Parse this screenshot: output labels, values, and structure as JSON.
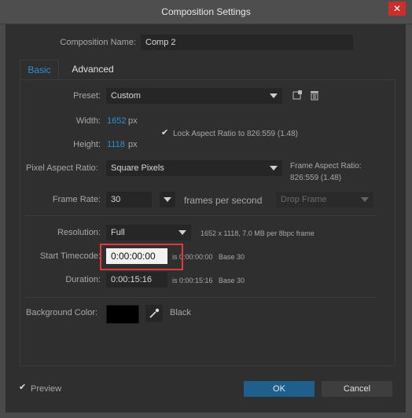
{
  "window": {
    "title": "Composition Settings",
    "close_label": "✕"
  },
  "comp_name": {
    "label": "Composition Name:",
    "value": "Comp 2"
  },
  "tabs": [
    {
      "label": "Basic",
      "active": true
    },
    {
      "label": "Advanced",
      "active": false
    }
  ],
  "preset": {
    "label": "Preset:",
    "value": "Custom"
  },
  "width": {
    "label": "Width:",
    "value": "1652",
    "unit": "px"
  },
  "height": {
    "label": "Height:",
    "value": "1118",
    "unit": "px"
  },
  "lock_aspect": {
    "checked": true,
    "label": "Lock Aspect Ratio to 826:559 (1.48)"
  },
  "pixel_aspect": {
    "label": "Pixel Aspect Ratio:",
    "value": "Square Pixels"
  },
  "frame_aspect": {
    "label": "Frame Aspect Ratio:",
    "value": "826:559 (1.48)"
  },
  "frame_rate": {
    "label": "Frame Rate:",
    "value": "30",
    "unit": "frames per second",
    "drop_frame": "Drop Frame"
  },
  "resolution": {
    "label": "Resolution:",
    "value": "Full",
    "info": "1652 x 1118, 7.0 MB per 8bpc frame"
  },
  "start_timecode": {
    "label": "Start Timecode:",
    "value": "0:00:00:00",
    "is": "is 0:00:00:00",
    "base": "Base 30"
  },
  "duration": {
    "label": "Duration:",
    "value": "0:00:15:16",
    "is": "is 0:00:15:16",
    "base": "Base 30"
  },
  "background": {
    "label": "Background Color:",
    "color_name": "Black",
    "color": "#000000"
  },
  "footer": {
    "preview_label": "Preview",
    "preview_checked": true,
    "ok": "OK",
    "cancel": "Cancel"
  },
  "colors": {
    "accent": "#2f8fd6",
    "highlight": "#e03a3a",
    "ok_button": "#1f5f8b"
  }
}
